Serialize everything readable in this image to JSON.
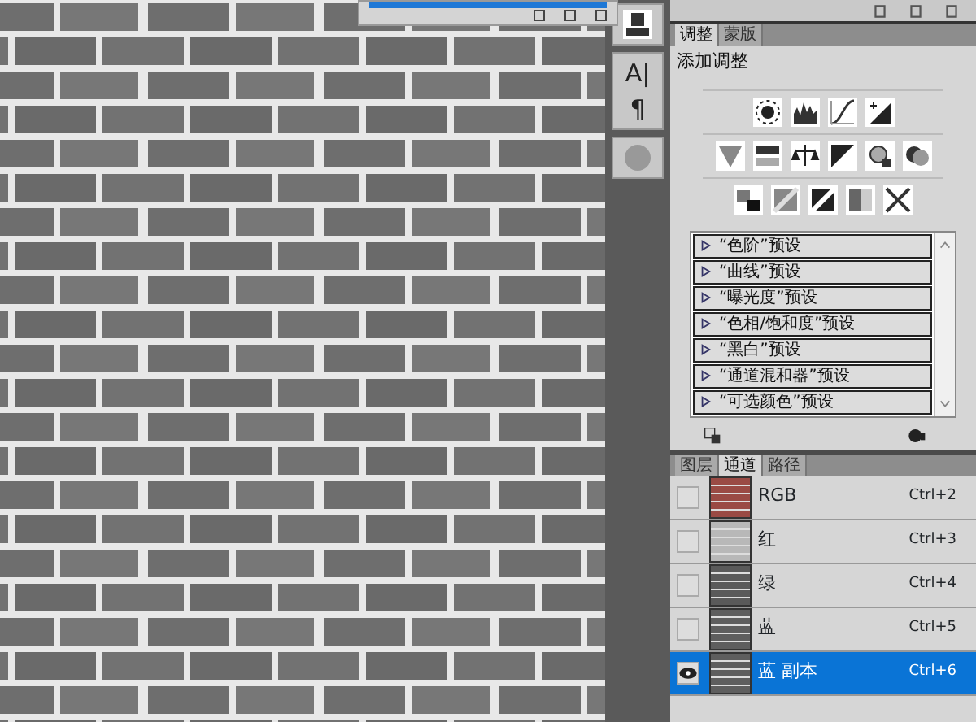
{
  "toolstrip": {
    "glyphs": [
      "A|",
      "¶"
    ]
  },
  "adjustments_panel": {
    "tabs": [
      {
        "label": "调整",
        "selected": true
      },
      {
        "label": "蒙版",
        "selected": false
      }
    ],
    "title": "添加调整",
    "presets": [
      {
        "label": "“色阶”预设"
      },
      {
        "label": "“曲线”预设"
      },
      {
        "label": "“曝光度”预设"
      },
      {
        "label": "“色相/饱和度”预设"
      },
      {
        "label": "“黑白”预设"
      },
      {
        "label": "“通道混和器”预设"
      },
      {
        "label": "“可选颜色”预设"
      }
    ]
  },
  "channels_panel": {
    "tabs": [
      {
        "label": "图层",
        "selected": false
      },
      {
        "label": "通道",
        "selected": true
      },
      {
        "label": "路径",
        "selected": false
      }
    ],
    "channels": [
      {
        "name": "RGB",
        "shortcut": "Ctrl+2",
        "visible": false,
        "selected": false,
        "color": "#9a4a44"
      },
      {
        "name": "红",
        "shortcut": "Ctrl+3",
        "visible": false,
        "selected": false,
        "color": "#b8b8b8"
      },
      {
        "name": "绿",
        "shortcut": "Ctrl+4",
        "visible": false,
        "selected": false,
        "color": "#5a5a5a"
      },
      {
        "name": "蓝",
        "shortcut": "Ctrl+5",
        "visible": false,
        "selected": false,
        "color": "#5e5e5e"
      },
      {
        "name": "蓝 副本",
        "shortcut": "Ctrl+6",
        "visible": true,
        "selected": true,
        "color": "#5e5e5e"
      }
    ]
  }
}
